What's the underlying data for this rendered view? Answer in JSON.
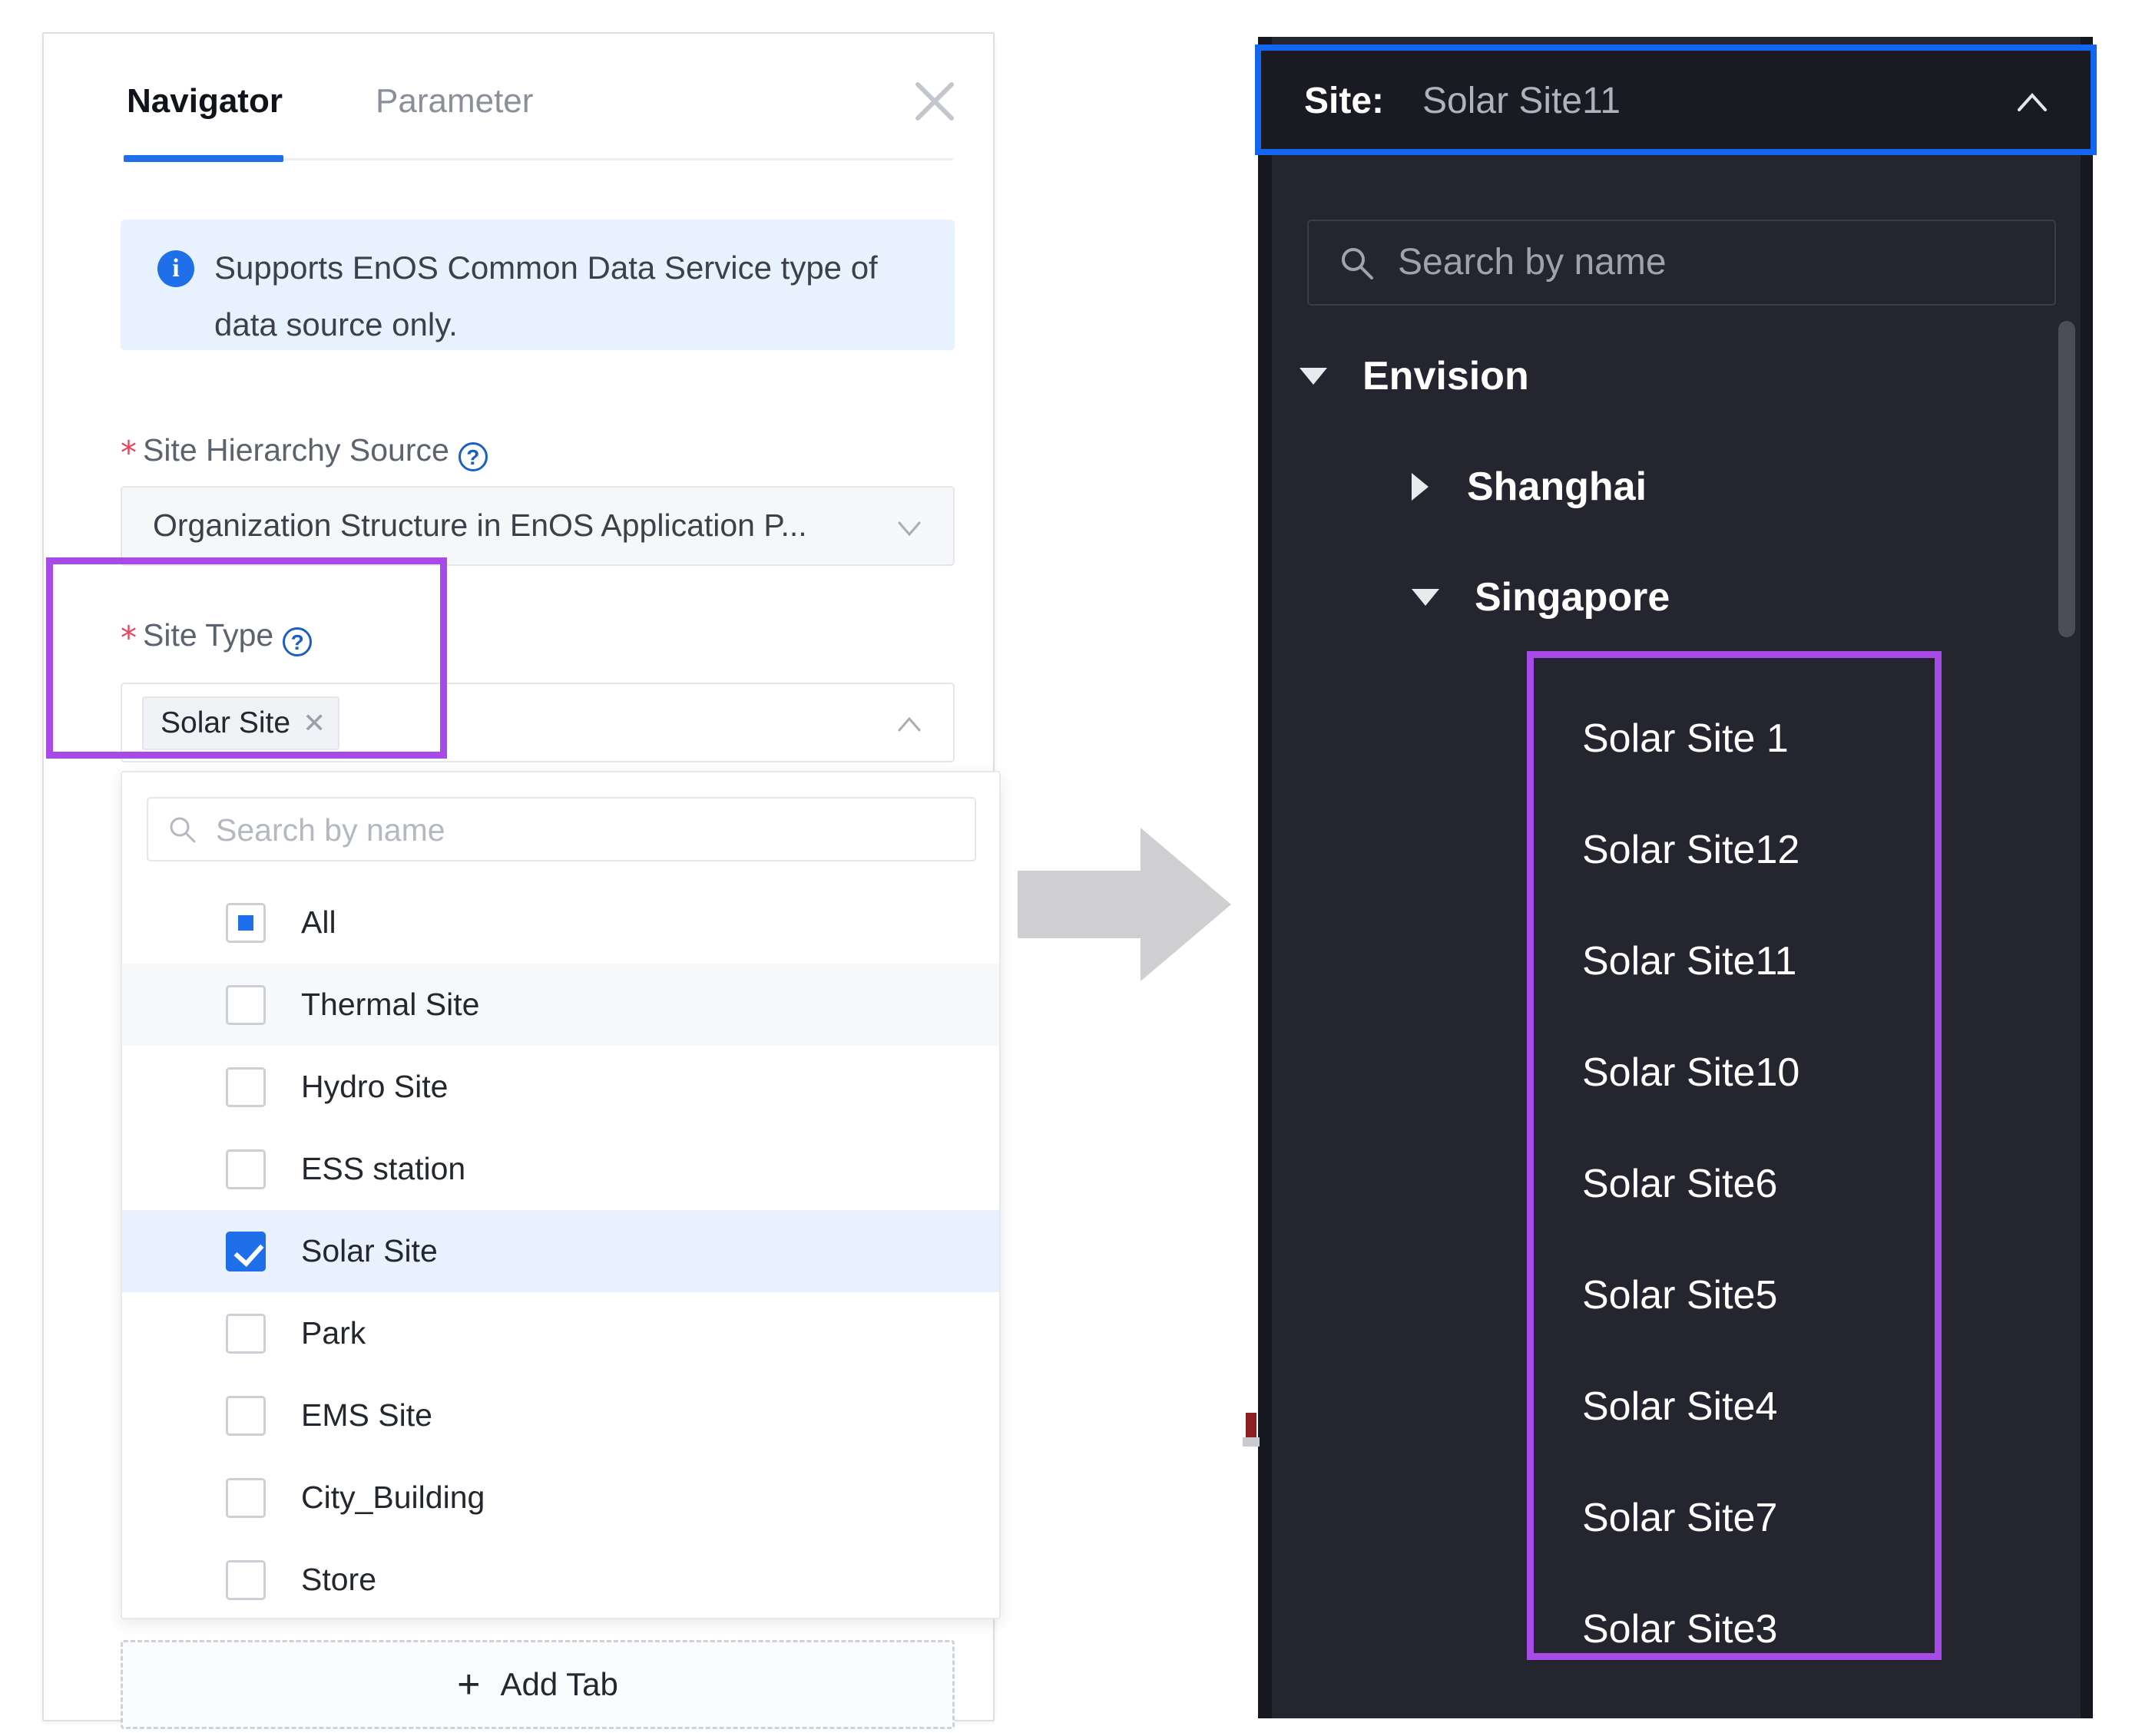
{
  "left_panel": {
    "tabs": [
      {
        "label": "Navigator",
        "active": true
      },
      {
        "label": "Parameter",
        "active": false
      }
    ],
    "close_icon": "close-icon",
    "info_banner": {
      "icon": "info-icon",
      "text": "Supports EnOS Common Data Service type of data source only."
    },
    "site_hierarchy_source": {
      "label": "Site Hierarchy Source",
      "required_marker": "*",
      "help_icon": "question-mark-icon",
      "value": "Organization Structure in EnOS Application P...",
      "chevron_icon": "chevron-down-icon"
    },
    "site_type": {
      "label": "Site Type",
      "required_marker": "*",
      "help_icon": "question-mark-icon",
      "selected_chip": "Solar Site",
      "chip_remove_icon": "close-small-icon",
      "caret_icon": "chevron-up-icon"
    },
    "dropdown": {
      "search_placeholder": "Search by name",
      "search_icon": "search-icon",
      "options": [
        {
          "label": "All",
          "state": "indeterminate",
          "row": "plain"
        },
        {
          "label": "Thermal Site",
          "state": "unchecked",
          "row": "alt"
        },
        {
          "label": "Hydro Site",
          "state": "unchecked",
          "row": "plain"
        },
        {
          "label": "ESS station",
          "state": "unchecked",
          "row": "plain"
        },
        {
          "label": "Solar Site",
          "state": "checked",
          "row": "selected"
        },
        {
          "label": "Park",
          "state": "unchecked",
          "row": "plain"
        },
        {
          "label": "EMS Site",
          "state": "unchecked",
          "row": "plain"
        },
        {
          "label": "City_Building",
          "state": "unchecked",
          "row": "plain"
        },
        {
          "label": "Store",
          "state": "unchecked",
          "row": "plain"
        }
      ]
    },
    "add_tab": {
      "plus": "+",
      "label": "Add Tab",
      "icon": "plus-icon"
    }
  },
  "flow": {
    "arrow_icon": "arrow-right-icon"
  },
  "right_panel": {
    "site_selector": {
      "label": "Site:",
      "value": "Solar Site11",
      "caret_icon": "chevron-up-icon"
    },
    "search": {
      "placeholder": "Search by name",
      "icon": "search-icon"
    },
    "tree": [
      {
        "label": "Envision",
        "expanded": true,
        "level": 0,
        "toggle_icon": "caret-down-icon"
      },
      {
        "label": "Shanghai",
        "expanded": false,
        "level": 1,
        "toggle_icon": "caret-right-icon"
      },
      {
        "label": "Singapore",
        "expanded": true,
        "level": 1,
        "toggle_icon": "caret-down-icon"
      }
    ],
    "sites": [
      "Solar Site 1",
      "Solar Site12",
      "Solar Site11",
      "Solar Site10",
      "Solar Site6",
      "Solar Site5",
      "Solar Site4",
      "Solar Site7",
      "Solar Site3"
    ]
  },
  "annotations": {
    "purple_box_color": "#a74ae8",
    "blue_box_color": "#1266f1"
  }
}
